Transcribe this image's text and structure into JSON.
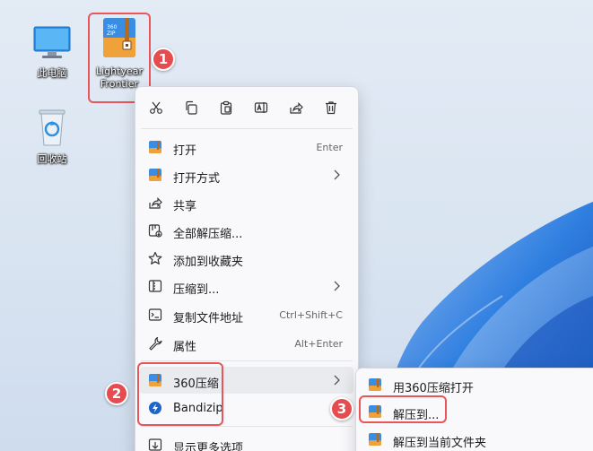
{
  "desktop": {
    "icons": [
      {
        "label": "此电脑",
        "icon": "monitor-icon"
      },
      {
        "label": "回收站",
        "icon": "recycle-bin-icon"
      },
      {
        "label": "Lightyear Frontier",
        "icon": "360zip-archive-icon"
      }
    ]
  },
  "callouts": [
    "1",
    "2",
    "3"
  ],
  "context_menu": {
    "toolbar": [
      {
        "name": "cut",
        "icon": "scissors-icon"
      },
      {
        "name": "copy",
        "icon": "copy-icon"
      },
      {
        "name": "paste",
        "icon": "paste-icon"
      },
      {
        "name": "rename",
        "icon": "rename-icon"
      },
      {
        "name": "share",
        "icon": "share-icon"
      },
      {
        "name": "delete",
        "icon": "trash-icon"
      }
    ],
    "items": [
      {
        "label": "打开",
        "shortcut": "Enter",
        "icon": "360zip-icon"
      },
      {
        "label": "打开方式",
        "shortcut": "",
        "icon": "360zip-icon",
        "submenu": true
      },
      {
        "label": "共享",
        "shortcut": "",
        "icon": "share-icon"
      },
      {
        "label": "全部解压缩...",
        "shortcut": "",
        "icon": "extract-icon"
      },
      {
        "label": "添加到收藏夹",
        "shortcut": "",
        "icon": "star-icon"
      },
      {
        "label": "压缩到...",
        "shortcut": "",
        "icon": "compress-icon",
        "submenu": true
      },
      {
        "label": "复制文件地址",
        "shortcut": "Ctrl+Shift+C",
        "icon": "path-icon"
      },
      {
        "label": "属性",
        "shortcut": "Alt+Enter",
        "icon": "wrench-icon"
      },
      {
        "label": "360压缩",
        "shortcut": "",
        "icon": "360zip-icon",
        "submenu": true
      },
      {
        "label": "Bandizip",
        "shortcut": "",
        "icon": "bandizip-icon"
      },
      {
        "label": "显示更多选项",
        "shortcut": "",
        "icon": "more-options-icon"
      }
    ]
  },
  "submenu": {
    "items": [
      {
        "label": "用360压缩打开",
        "icon": "360zip-icon"
      },
      {
        "label": "解压到...",
        "icon": "360zip-icon"
      },
      {
        "label": "解压到当前文件夹",
        "icon": "360zip-icon"
      }
    ]
  },
  "colors": {
    "callout_red": "#e54b4f",
    "zip_blue": "#3a8de0",
    "zip_orange": "#f0a23a",
    "wallpaper_blue": "#1e6fd6"
  }
}
